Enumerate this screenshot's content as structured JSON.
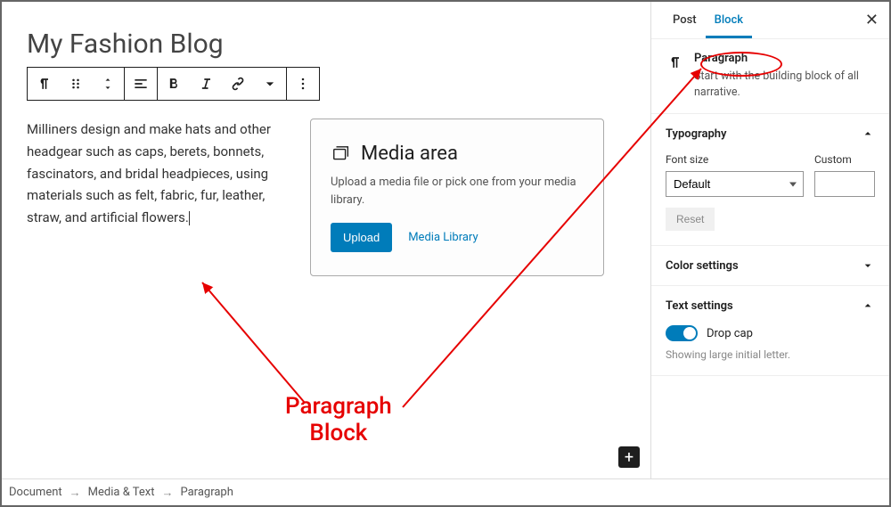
{
  "page": {
    "title": "My Fashion Blog"
  },
  "paragraph": {
    "text": "Milliners design and make hats and other headgear such as caps, berets, bonnets, fascinators, and bridal headpieces, using materials such as felt, fabric, fur, leather, straw, and artificial flowers."
  },
  "media": {
    "title": "Media area",
    "description": "Upload a media file or pick one from your media library.",
    "upload_label": "Upload",
    "library_label": "Media Library"
  },
  "sidebar": {
    "tabs": {
      "post": "Post",
      "block": "Block"
    },
    "block": {
      "name": "Paragraph",
      "description": "Start with the building block of all narrative."
    },
    "typography": {
      "title": "Typography",
      "font_size_label": "Font size",
      "custom_label": "Custom",
      "font_size_value": "Default",
      "custom_value": "",
      "reset": "Reset"
    },
    "color_settings": {
      "title": "Color settings"
    },
    "text_settings": {
      "title": "Text settings",
      "drop_cap": "Drop cap",
      "drop_cap_help": "Showing large initial letter."
    }
  },
  "breadcrumb": {
    "doc": "Document",
    "media_text": "Media & Text",
    "paragraph": "Paragraph"
  },
  "annotation": {
    "label_line1": "Paragraph",
    "label_line2": "Block"
  }
}
